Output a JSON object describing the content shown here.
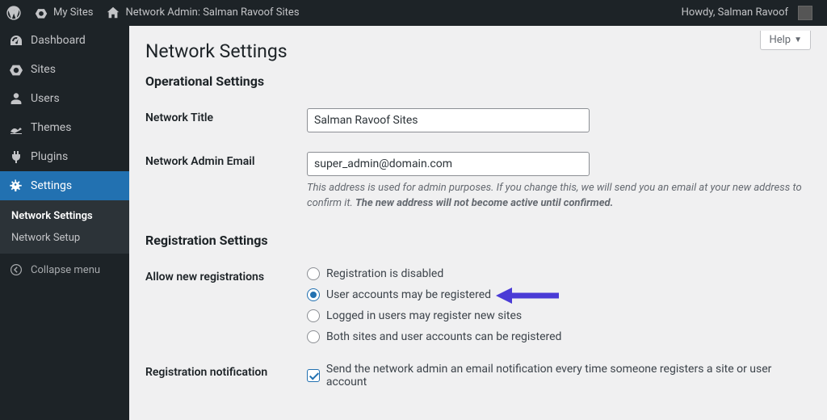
{
  "adminbar": {
    "mysites_label": "My Sites",
    "networkadmin_label": "Network Admin: Salman Ravoof Sites",
    "howdy_label": "Howdy, Salman Ravoof"
  },
  "sidebar": {
    "dashboard": "Dashboard",
    "sites": "Sites",
    "users": "Users",
    "themes": "Themes",
    "plugins": "Plugins",
    "settings": "Settings",
    "submenu": {
      "network_settings": "Network Settings",
      "network_setup": "Network Setup"
    },
    "collapse": "Collapse menu"
  },
  "content": {
    "help_label": "Help",
    "page_title": "Network Settings",
    "sections": {
      "operational_title": "Operational Settings",
      "registration_title": "Registration Settings"
    },
    "fields": {
      "network_title_label": "Network Title",
      "network_title_value": "Salman Ravoof Sites",
      "admin_email_label": "Network Admin Email",
      "admin_email_value": "super_admin@domain.com",
      "admin_email_desc_lead": "This address is used for admin purposes. If you change this, we will send you an email at your new address to confirm it. ",
      "admin_email_desc_strong": "The new address will not become active until confirmed.",
      "allow_registrations_label": "Allow new registrations",
      "registration_options": {
        "none": "Registration is disabled",
        "user": "User accounts may be registered",
        "blog": "Logged in users may register new sites",
        "all": "Both sites and user accounts can be registered"
      },
      "registration_notification_label": "Registration notification",
      "registration_notification_checkbox": "Send the network admin an email notification every time someone registers a site or user account"
    }
  }
}
